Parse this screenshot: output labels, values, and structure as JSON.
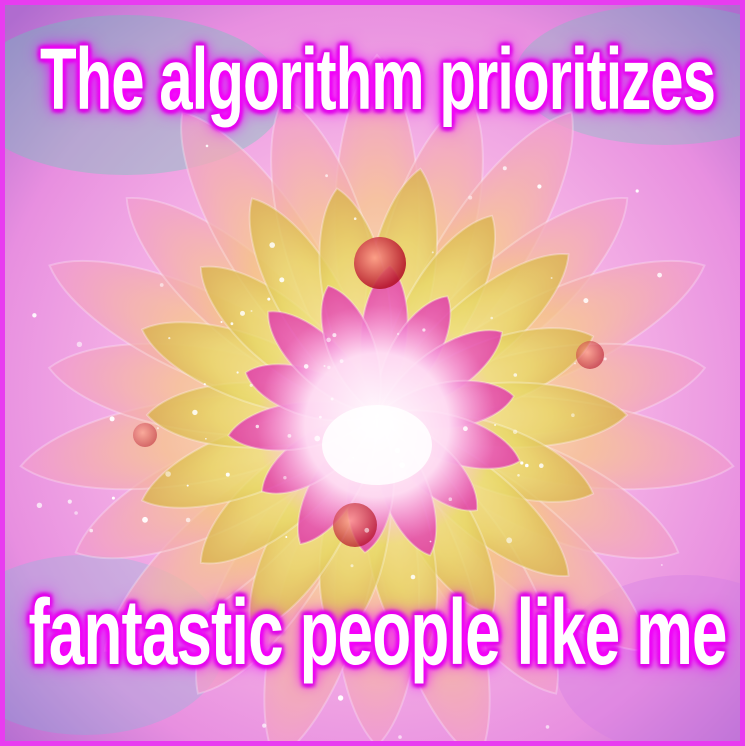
{
  "meme": {
    "caption_top": "The algorithm prioritizes",
    "caption_bottom": "fantastic people like me"
  },
  "colors": {
    "frame": "#e83cf0",
    "text": "#ffffff",
    "glow": "#ff00ff",
    "petal_outer": "#f6c48a",
    "petal_mid": "#e9d86a",
    "petal_inner": "#f06ac8",
    "center": "#fff2fb",
    "background": "#f3b6ea"
  },
  "icons": {
    "artwork": "flower-icon"
  }
}
